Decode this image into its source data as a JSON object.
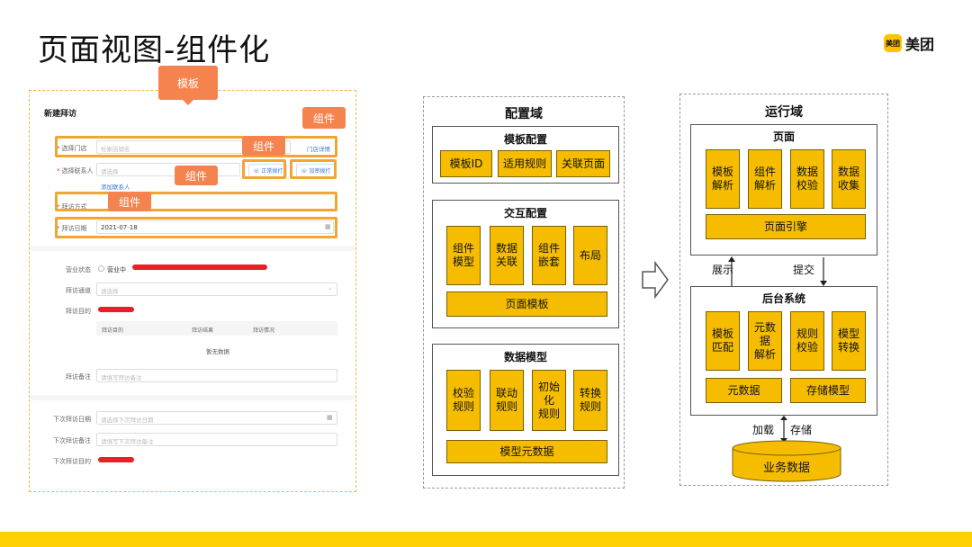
{
  "slide": {
    "title": "页面视图-组件化",
    "logo_badge": "美团",
    "logo_text": "美团"
  },
  "form": {
    "title": "新建拜访",
    "fields": {
      "store_label": "选择门店",
      "store_placeholder": "检索店铺名",
      "store_detail_link": "门店详情",
      "contact_label": "选择联系人",
      "contact_placeholder": "请选择",
      "add_contact_link": "添加联系人",
      "call_btn": "正常拨打",
      "encrypted_call_btn": "加密拨打",
      "method_label": "拜访方式",
      "date_label": "拜访日期",
      "date_value": "2021-07-18",
      "business_status_label": "营业状态",
      "business_status_option": "营业中",
      "channel_label": "拜访通道",
      "channel_placeholder": "请选择",
      "purpose_label": "拜访目的",
      "remark_label": "拜访备注",
      "remark_placeholder": "请填写拜访备注",
      "next_date_label": "下次拜访日期",
      "next_date_placeholder": "请选择下次拜访日期",
      "next_remark_label": "下次拜访备注",
      "next_remark_placeholder": "请填写下次拜访备注",
      "next_purpose_label": "下次拜访目的"
    },
    "table": {
      "headers": [
        "拜访目的",
        "拜访结果",
        "拜访情况"
      ],
      "empty": "暂无数据"
    },
    "callouts": {
      "template": "模板",
      "component": "组件"
    }
  },
  "config_domain": {
    "title": "配置域",
    "template_config": {
      "title": "模板配置",
      "items": [
        "模板ID",
        "适用规则",
        "关联页面"
      ]
    },
    "interaction_config": {
      "title": "交互配置",
      "items": [
        "组件\n模型",
        "数据\n关联",
        "组件\n嵌套",
        "布局"
      ],
      "footer": "页面模板"
    },
    "data_model": {
      "title": "数据模型",
      "items": [
        "校验\n规则",
        "联动\n规则",
        "初始\n化\n规则",
        "转换\n规则"
      ],
      "footer": "模型元数据"
    }
  },
  "runtime_domain": {
    "title": "运行域",
    "page": {
      "title": "页面",
      "items": [
        "模板\n解析",
        "组件\n解析",
        "数据\n校验",
        "数据\n收集"
      ],
      "footer": "页面引擎"
    },
    "show_label": "展示",
    "submit_label": "提交",
    "backend": {
      "title": "后台系统",
      "items": [
        "模板\n匹配",
        "元数\n据\n解析",
        "规则\n校验",
        "模型\n转换"
      ],
      "footer_left": "元数据",
      "footer_right": "存储模型"
    },
    "load_label": "加载",
    "store_label": "存储",
    "database": "业务数据"
  },
  "colors": {
    "accent_yellow": "#f6bd00",
    "callout_orange": "#f5834e",
    "highlight_orange": "#f2a632",
    "brand_yellow": "#ffd100"
  }
}
